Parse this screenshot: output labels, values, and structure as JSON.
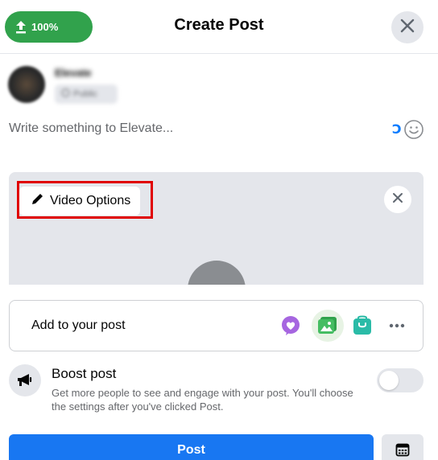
{
  "header": {
    "upload_badge": "100%",
    "title": "Create Post"
  },
  "author": {
    "name": "Elevate",
    "privacy": "Public"
  },
  "composer": {
    "placeholder": "Write something to Elevate...",
    "text_tool_glyph": "Ↄ"
  },
  "video": {
    "options_label": "Video Options"
  },
  "add_to_post": {
    "label": "Add to your post",
    "icons": [
      "heart-bubble-icon",
      "photo-video-icon",
      "shopping-bag-icon",
      "more-icon"
    ]
  },
  "boost": {
    "title": "Boost post",
    "description": "Get more people to see and engage with your post. You'll choose the settings after you've clicked Post."
  },
  "footer": {
    "post_label": "Post"
  },
  "colors": {
    "upload_green": "#31a24c",
    "primary_blue": "#1877f2",
    "highlight_red": "#e00000"
  }
}
